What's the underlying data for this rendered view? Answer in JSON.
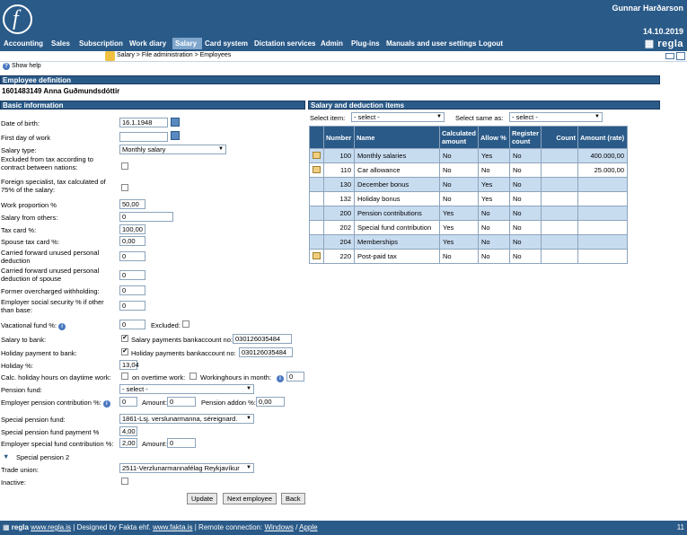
{
  "user": "Gunnar Harðarson",
  "date": "14.10.2019",
  "brand": "regla",
  "nav": [
    "Accounting",
    "Sales",
    "Subscription",
    "Work diary",
    "Salary",
    "Card system",
    "Dictation services",
    "Admin",
    "Plug-ins",
    "Manuals and user settings",
    "Logout"
  ],
  "breadcrumb": "Salary > File administration > Employees",
  "show_help": "Show help",
  "employee_definition": "Employee definition",
  "employee_id_name": "1601483149   Anna Guðmundsdóttir",
  "basic_info_title": "Basic information",
  "salary_items_title": "Salary and deduction items",
  "select_item_label": "Select item:",
  "select_item_value": "- select -",
  "select_same_label": "Select same as:",
  "select_same_value": "- select -",
  "fields": {
    "date_of_birth": {
      "label": "Date of birth:",
      "value": "16.1.1948"
    },
    "first_day": {
      "label": "First day of work",
      "value": ""
    },
    "salary_type": {
      "label": "Salary type:",
      "value": "Monthly salary"
    },
    "excluded_tax": {
      "label": "Excluded from tax according to contract between nations:"
    },
    "foreign_specialist": {
      "label": "Foreign specialist, tax calculated of 75% of the salary:"
    },
    "work_proportion": {
      "label": "Work proportion %",
      "value": "50,00"
    },
    "salary_others": {
      "label": "Salary from others:",
      "value": "0"
    },
    "tax_card": {
      "label": "Tax card %:",
      "value": "100,00"
    },
    "spouse_tax": {
      "label": "Spouse tax card %:",
      "value": "0,00"
    },
    "carried_personal": {
      "label": "Carried forward unused personal deduction",
      "value": "0"
    },
    "carried_spouse": {
      "label": "Carried forward unused personal deduction of spouse",
      "value": "0"
    },
    "former_over": {
      "label": "Former overcharged withholding:",
      "value": "0"
    },
    "employer_social": {
      "label": "Employer social security % if other than base:",
      "value": "0"
    },
    "vacational_fund": {
      "label": "Vacational fund %:",
      "value": "0",
      "excluded": "Excluded:"
    },
    "salary_bank": {
      "label": "Salary to bank:",
      "text": "Salary payments bankaccount no:",
      "value": "030126035484"
    },
    "holiday_bank": {
      "label": "Holiday payment to bank:",
      "text": "Holiday payments bankaccount no:",
      "value": "030126035484"
    },
    "holiday_pct": {
      "label": "Holiday %:",
      "value": "13,04"
    },
    "calc_holiday": {
      "label": "Calc. holiday hours on daytime work:",
      "overtime": "on overtime work:",
      "workinghours": "Workinghours in month:",
      "value": "0"
    },
    "pension_fund": {
      "label": "Pension fund:",
      "value": "- select -"
    },
    "employer_pension": {
      "label": "Employer pension contribution %:",
      "value": "0",
      "amount_label": "Amount:",
      "amount": "0",
      "addon_label": "Pension addon %:",
      "addon": "0,00"
    },
    "special_pension": {
      "label": "Special pension fund:",
      "value": "1861-Lsj. verslunarmanna, séreignard."
    },
    "special_payment": {
      "label": "Special pension fund payment %",
      "value": "4,00"
    },
    "employer_special": {
      "label": "Employer special fund contribution %:",
      "value": "2,00",
      "amount_label": "Amount:",
      "amount": "0"
    },
    "special_pension_2": {
      "label": "Special pension 2"
    },
    "trade_union": {
      "label": "Trade union:",
      "value": "2511-Verzlunarmannafélag Reykjavíkur"
    },
    "inactive": {
      "label": "Inactive:"
    }
  },
  "table": {
    "headers": [
      "",
      "Number",
      "Name",
      "Calculated amount",
      "Allow %",
      "Register count",
      "Count",
      "Amount (rate)"
    ],
    "rows": [
      {
        "icon": true,
        "number": "100",
        "name": "Monthly salaries",
        "calc": "No",
        "allow": "Yes",
        "register": "No",
        "count": "",
        "amount": "400.000,00",
        "shade": true
      },
      {
        "icon": true,
        "number": "110",
        "name": "Car allowance",
        "calc": "No",
        "allow": "No",
        "register": "No",
        "count": "",
        "amount": "25.000,00",
        "shade": false
      },
      {
        "icon": false,
        "number": "130",
        "name": "December bonus",
        "calc": "No",
        "allow": "Yes",
        "register": "No",
        "count": "",
        "amount": "",
        "shade": true
      },
      {
        "icon": false,
        "number": "132",
        "name": "Holiday bonus",
        "calc": "No",
        "allow": "Yes",
        "register": "No",
        "count": "",
        "amount": "",
        "shade": false
      },
      {
        "icon": false,
        "number": "200",
        "name": "Pension contributions",
        "calc": "Yes",
        "allow": "No",
        "register": "No",
        "count": "",
        "amount": "",
        "shade": true
      },
      {
        "icon": false,
        "number": "202",
        "name": "Special fund contribution",
        "calc": "Yes",
        "allow": "No",
        "register": "No",
        "count": "",
        "amount": "",
        "shade": false
      },
      {
        "icon": false,
        "number": "204",
        "name": "Memberships",
        "calc": "Yes",
        "allow": "No",
        "register": "No",
        "count": "",
        "amount": "",
        "shade": true
      },
      {
        "icon": true,
        "number": "220",
        "name": "Post-paid tax",
        "calc": "No",
        "allow": "No",
        "register": "No",
        "count": "",
        "amount": "",
        "shade": false
      }
    ]
  },
  "buttons": {
    "update": "Update",
    "next": "Next employee",
    "back": "Back"
  },
  "footer": {
    "brand": "regla",
    "link1": "www.regla.is",
    "designed": " | Designed by Fakta ehf. ",
    "link2": "www.fakta.is",
    "remote": " | Remote connection: ",
    "windows": "Windows",
    "slash": " / ",
    "apple": "Apple",
    "page": "11"
  }
}
